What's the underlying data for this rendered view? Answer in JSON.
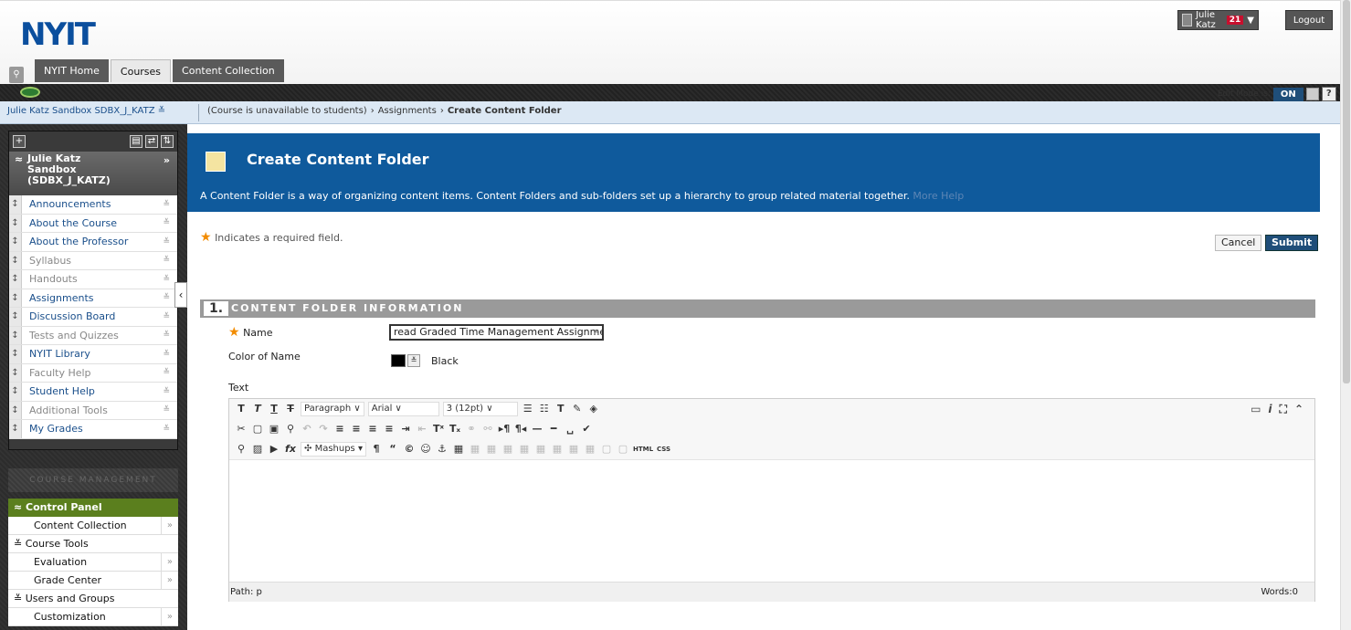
{
  "header": {
    "logo": "NYIT",
    "user_name": "Julie Katz",
    "notification_count": "21",
    "logout_label": "Logout",
    "tabs": [
      {
        "label": "NYIT Home"
      },
      {
        "label": "Courses"
      },
      {
        "label": "Content Collection"
      }
    ],
    "edit_mode_label": "Edit Mode is:",
    "edit_mode_value": "ON",
    "help_label": "?"
  },
  "breadcrumb": {
    "course": "Julie Katz Sandbox SDBX_J_KATZ",
    "items": [
      "(Course is unavailable to students)",
      "Assignments",
      "Create Content Folder"
    ]
  },
  "course_menu": {
    "course_title_line1": "Julie Katz",
    "course_title_line2": "Sandbox",
    "course_title_line3": "(SDBX_J_KATZ)",
    "items": [
      {
        "label": "Announcements",
        "muted": false
      },
      {
        "label": "About the Course",
        "muted": false
      },
      {
        "label": "About the Professor",
        "muted": false
      },
      {
        "label": "Syllabus",
        "muted": true
      },
      {
        "label": "Handouts",
        "muted": true
      },
      {
        "label": "Assignments",
        "muted": false
      },
      {
        "label": "Discussion Board",
        "muted": false
      },
      {
        "label": "Tests and Quizzes",
        "muted": true
      },
      {
        "label": "NYIT Library",
        "muted": false
      },
      {
        "label": "Faculty Help",
        "muted": true
      },
      {
        "label": "Student Help",
        "muted": false
      },
      {
        "label": "Additional Tools",
        "muted": true
      },
      {
        "label": "My Grades",
        "muted": false
      }
    ]
  },
  "course_management": {
    "header": "COURSE MANAGEMENT",
    "control_panel": "Control Panel",
    "content_collection": "Content Collection",
    "course_tools": "Course Tools",
    "evaluation": "Evaluation",
    "grade_center": "Grade Center",
    "users_groups": "Users and Groups",
    "customization": "Customization"
  },
  "page": {
    "title": "Create Content Folder",
    "description": "A Content Folder is a way of organizing content items. Content Folders and sub-folders set up a hierarchy to group related material together.",
    "more_help": "More Help",
    "required_note": "Indicates a required field.",
    "cancel_label": "Cancel",
    "submit_label": "Submit",
    "section_number": "1.",
    "section_title": "CONTENT FOLDER INFORMATION",
    "name_label": "Name",
    "name_value": "read Graded Time Management Assignme",
    "color_label": "Color of Name",
    "color_value": "Black",
    "text_label": "Text"
  },
  "editor": {
    "paragraph": "Paragraph",
    "font": "Arial",
    "size": "3 (12pt)",
    "mashups": "Mashups",
    "path_label": "Path: p",
    "words_label": "Words:0"
  }
}
